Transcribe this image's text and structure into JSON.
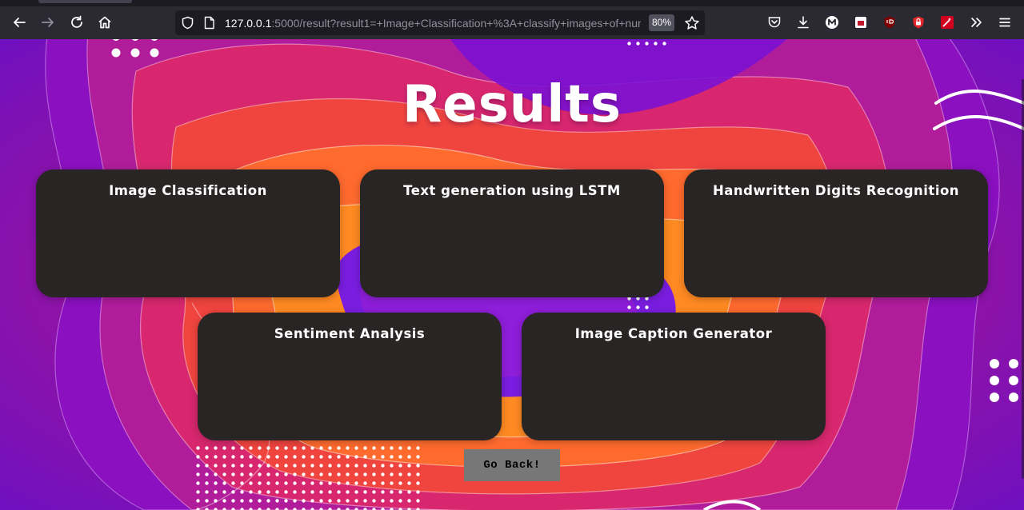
{
  "browser": {
    "url_host": "127.0.0.1",
    "url_rest": ":5000/result?result1=+Image+Classification+%3A+classify+images+of+numb",
    "zoom": "80%",
    "toolbar_icons": [
      "back-icon",
      "forward-icon",
      "reload-icon",
      "home-icon",
      "shield-icon",
      "page-icon",
      "star-icon",
      "pocket-icon",
      "download-icon",
      "account-m-icon",
      "addon-icon",
      "ublock-icon",
      "lock-addon-icon",
      "magic-wand-icon",
      "overflow-icon",
      "menu-icon"
    ],
    "colors": {
      "toolbar": "#2b2a33",
      "urlbar": "#1c1b22"
    }
  },
  "page": {
    "title": "Results",
    "cards": [
      {
        "title": "Image Classification",
        "body": ""
      },
      {
        "title": "Text generation using LSTM",
        "body": ""
      },
      {
        "title": "Handwritten Digits Recognition",
        "body": ""
      },
      {
        "title": "Sentiment Analysis",
        "body": ""
      },
      {
        "title": "Image Caption Generator",
        "body": ""
      }
    ],
    "go_back_label": "Go Back!",
    "colors": {
      "card": "#2a2525",
      "button": "#777777",
      "title": "#ffffff"
    }
  }
}
